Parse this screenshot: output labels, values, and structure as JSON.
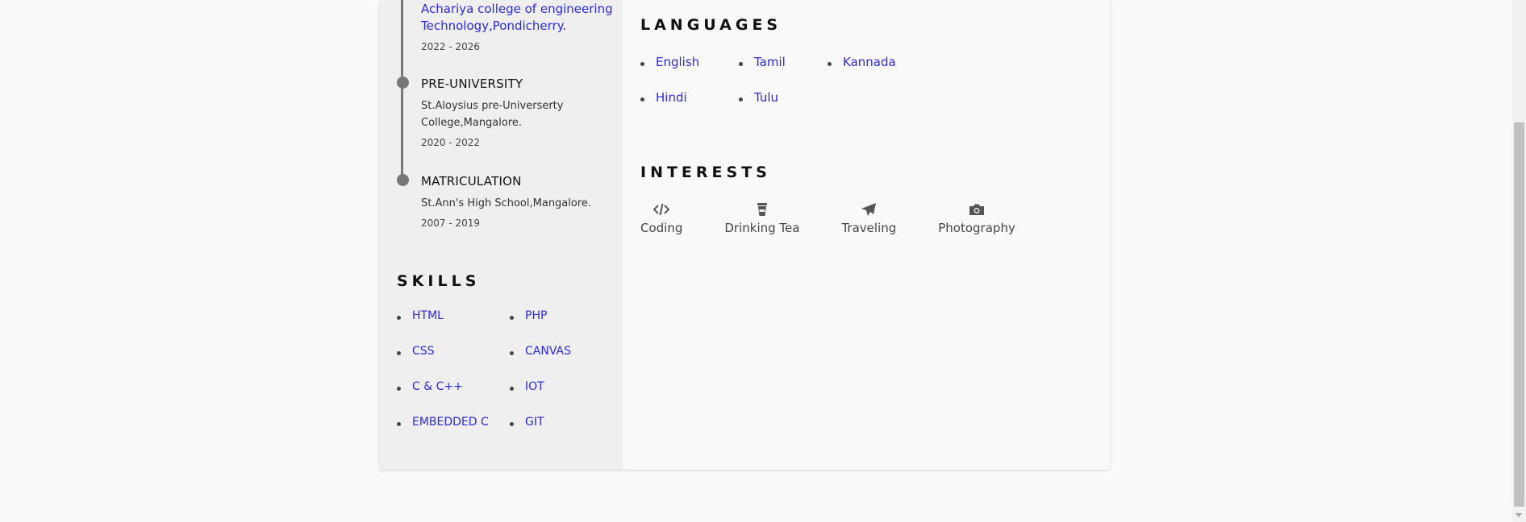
{
  "education": [
    {
      "title": "",
      "place": "Achariya college of engineering Technology,Pondicherry.",
      "years": "2022 - 2026"
    },
    {
      "title": "PRE-UNIVERSITY",
      "place": "St.Aloysius pre-Universerty College,Mangalore.",
      "years": "2020 - 2022"
    },
    {
      "title": "MATRICULATION",
      "place": "St.Ann's High School,Mangalore.",
      "years": "2007 - 2019"
    }
  ],
  "skills": {
    "heading": "SKILLS",
    "items": [
      "HTML",
      "PHP",
      "CSS",
      "CANVAS",
      "C & C++",
      "IOT",
      "EMBEDDED C",
      "GIT"
    ]
  },
  "languages": {
    "heading": "LANGUAGES",
    "items": [
      "English",
      "Tamil",
      "Kannada",
      "Hindi",
      "Tulu"
    ]
  },
  "interests": {
    "heading": "INTERESTS",
    "items": [
      {
        "label": "Coding",
        "icon": "code-icon"
      },
      {
        "label": "Drinking Tea",
        "icon": "cup-icon"
      },
      {
        "label": "Traveling",
        "icon": "plane-icon"
      },
      {
        "label": "Photography",
        "icon": "camera-icon"
      }
    ]
  },
  "colors": {
    "link": "#2a2ad8",
    "sidebar_bg": "#efefef",
    "timeline": "#777777"
  }
}
